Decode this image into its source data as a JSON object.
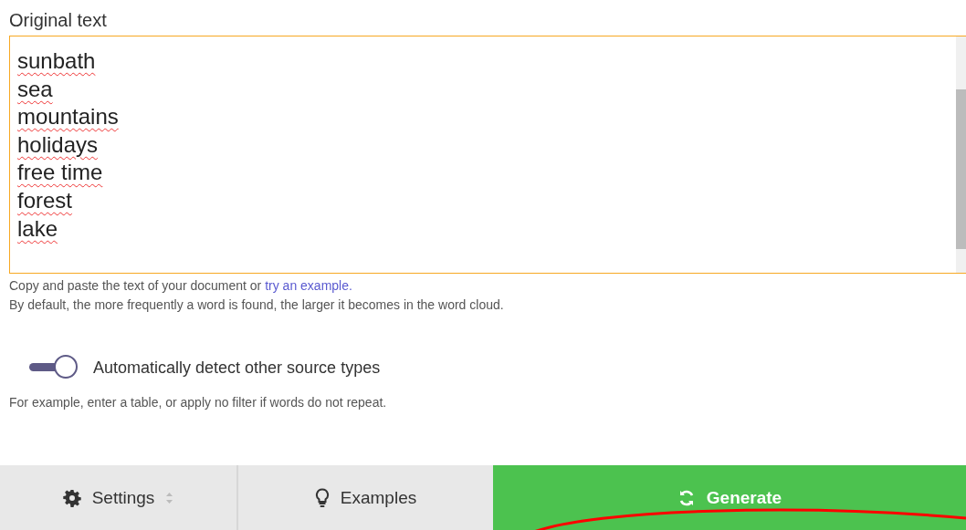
{
  "label": "Original text",
  "text_lines": [
    "sunbath",
    "sea",
    "mountains",
    "holidays",
    "free time",
    "forest",
    "lake"
  ],
  "help": {
    "text": "Copy and paste the text of your document or",
    "link": "try an example."
  },
  "help_2": "By default, the more frequently a word is found, the larger it becomes in the word cloud.",
  "toggle": {
    "label": "Automatically detect other source types",
    "on": true
  },
  "hint": "For example, enter a table, or apply no filter if words do not repeat.",
  "buttons": [
    {
      "kind": "settings",
      "label": "Settings"
    },
    {
      "kind": "examples",
      "label": "Examples"
    },
    {
      "kind": "generate",
      "label": "Generate"
    }
  ]
}
